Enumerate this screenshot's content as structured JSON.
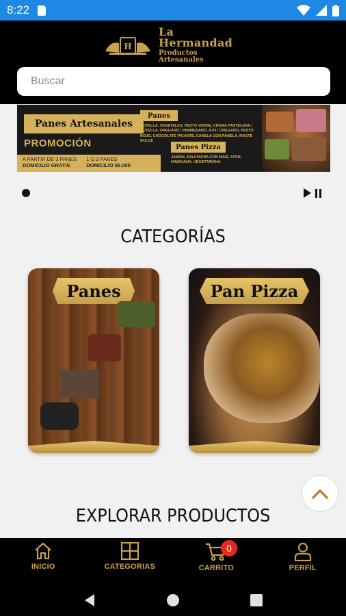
{
  "status": {
    "time": "8:22"
  },
  "brand": {
    "title": "La Hermandad",
    "subtitle": "Productos Artesanales"
  },
  "search": {
    "placeholder": "Buscar"
  },
  "banner": {
    "title": "Panes Artesanales",
    "promo": "PROMOCIÓN",
    "offer1_line1": "A PARTIR DE 3 PANES",
    "offer1_line2": "DOMICILIO GRATIS",
    "offer2_line1": "1 O 2 PANES",
    "offer2_line2": "DOMICILIO $5.000",
    "panes_label": "Panes",
    "panes_list": "NUTELLA, VEGETALES, PESTO VERDE, CREMA PASTELERA / NUTELLA, OREGANO / PARMESANO, AJO / OREGANO, PESTO ROJO, CHOCOLATE PICANTE, CANELA CON PANELA, MASTE DULCE",
    "pizza_label": "Panes Pizza",
    "pizza_list": "JAMÓN, SALCHICHA CON MAÍZ, ATÚN, HAWAIANA, VEGETARIANA"
  },
  "categories": {
    "title": "CATEGORÍAS",
    "items": [
      {
        "label": "Panes"
      },
      {
        "label": "Pan Pizza"
      }
    ]
  },
  "explore": {
    "title": "EXPLORAR PRODUCTOS"
  },
  "nav": {
    "items": [
      {
        "label": "INICIO",
        "icon": "home-icon"
      },
      {
        "label": "CATEGORIAS",
        "icon": "grid-icon"
      },
      {
        "label": "CARRITO",
        "icon": "cart-icon",
        "badge": "0"
      },
      {
        "label": "PERFIL",
        "icon": "person-icon"
      }
    ]
  },
  "colors": {
    "gold": "#c9a14a",
    "status_blue": "#1e88e5",
    "badge_red": "#e8281e"
  }
}
